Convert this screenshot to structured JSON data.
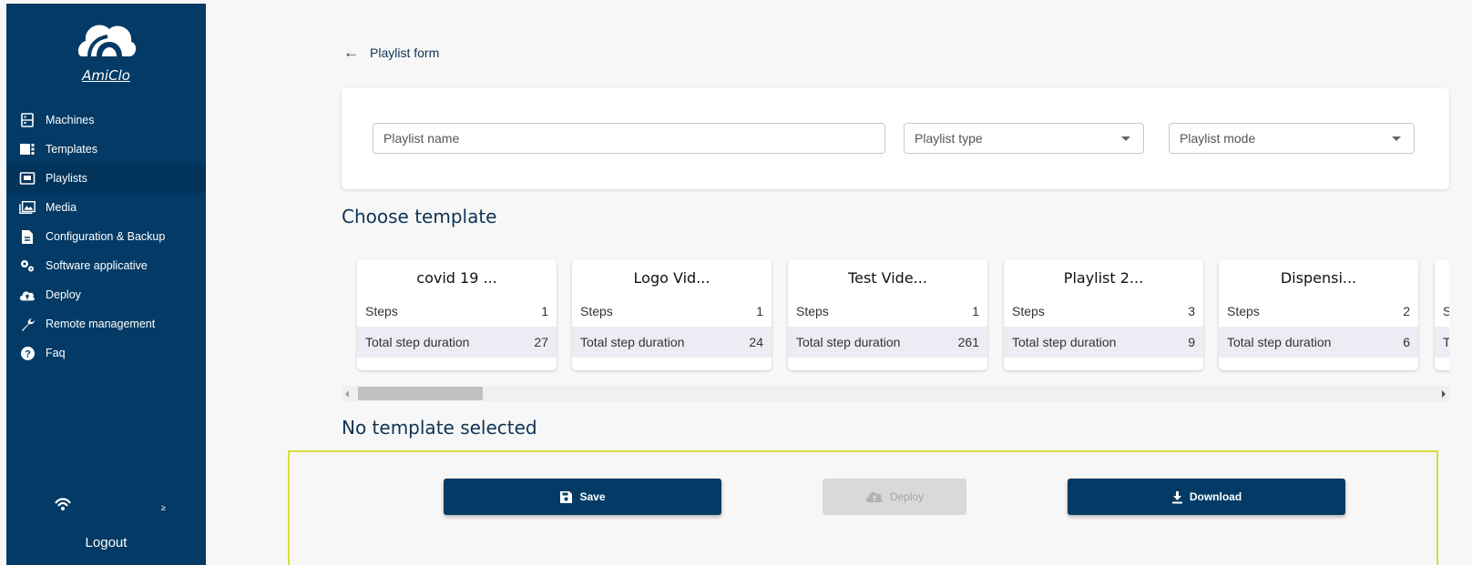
{
  "app": {
    "logo_text": "AmiClo"
  },
  "sidebar": {
    "items": [
      {
        "label": "Machines",
        "icon": "machine-icon"
      },
      {
        "label": "Templates",
        "icon": "templates-icon"
      },
      {
        "label": "Playlists",
        "icon": "playlist-icon",
        "active": true
      },
      {
        "label": "Media",
        "icon": "media-icon"
      },
      {
        "label": "Configuration & Backup",
        "icon": "document-icon"
      },
      {
        "label": "Software applicative",
        "icon": "gears-icon"
      },
      {
        "label": "Deploy",
        "icon": "cloud-upload-icon"
      },
      {
        "label": "Remote management",
        "icon": "wrench-icon"
      },
      {
        "label": "Faq",
        "icon": "help-icon"
      }
    ],
    "lang_badge": "≥",
    "logout_label": "Logout"
  },
  "header": {
    "title": "Playlist form"
  },
  "form": {
    "name_placeholder": "Playlist name",
    "type_placeholder": "Playlist type",
    "mode_placeholder": "Playlist mode"
  },
  "choose_template_title": "Choose template",
  "templates": [
    {
      "name": "covid 19 ...",
      "steps_label": "Steps",
      "steps": "1",
      "duration_label": "Total step duration",
      "duration": "27"
    },
    {
      "name": "Logo Vid...",
      "steps_label": "Steps",
      "steps": "1",
      "duration_label": "Total step duration",
      "duration": "24"
    },
    {
      "name": "Test Vide...",
      "steps_label": "Steps",
      "steps": "1",
      "duration_label": "Total step duration",
      "duration": "261"
    },
    {
      "name": "Playlist 2...",
      "steps_label": "Steps",
      "steps": "3",
      "duration_label": "Total step duration",
      "duration": "9"
    },
    {
      "name": "Dispensi...",
      "steps_label": "Steps",
      "steps": "2",
      "duration_label": "Total step duration",
      "duration": "6"
    },
    {
      "name": "",
      "steps_label": "S",
      "steps": "",
      "duration_label": "T",
      "duration": ""
    }
  ],
  "no_template_title": "No template selected",
  "actions": {
    "save_label": "Save",
    "deploy_label": "Deploy",
    "download_label": "Download"
  },
  "colors": {
    "primary": "#033b66",
    "highlight_border": "#d8dd3a"
  }
}
